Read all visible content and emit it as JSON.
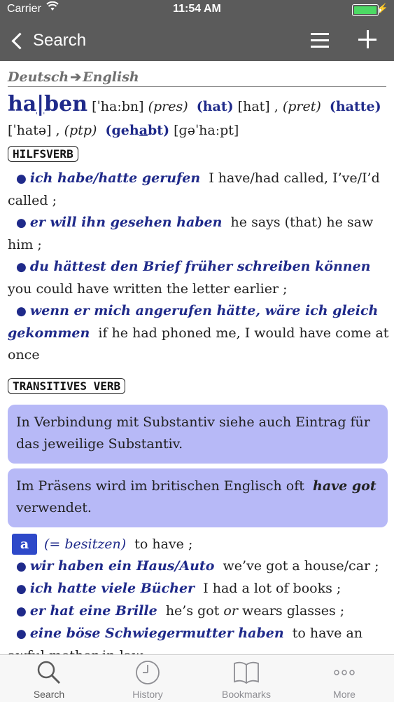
{
  "status_bar": {
    "carrier": "Carrier",
    "time": "11:54 AM"
  },
  "nav": {
    "back_label": "Search"
  },
  "direction": {
    "from": "Deutsch",
    "to": "English"
  },
  "entry": {
    "headword_pre": "ha",
    "headword_accent": "|",
    "headword_post": "ben",
    "pron": "[ˈhaːbn]",
    "pres_label": "(pres)",
    "pres_form": "(hat)",
    "pres_pron": "[hat] ,",
    "pret_label": "(pret)",
    "pret_form": "(hatte)",
    "pret_pron": "[ˈhatə] ,",
    "ptp_label": "(ptp)",
    "ptp_form_pre": "(geh",
    "ptp_form_accent": "a",
    "ptp_form_post": "bt)",
    "ptp_pron": "[ɡəˈhaːpt]"
  },
  "hilfsverb": {
    "label": "HILFSVERB",
    "examples": [
      {
        "de": "ich habe/hatte gerufen",
        "en": "I have/had called, I’ve/I’d called ;"
      },
      {
        "de": "er will ihn gesehen haben",
        "en": "he says (that) he saw him ;"
      },
      {
        "de": "du hättest den Brief früher schreiben können",
        "en": "you could have written the letter earlier ;"
      },
      {
        "de": "wenn er mich angerufen hätte, wäre ich gleich gekommen",
        "en": "if he had phoned me, I would have come at once"
      }
    ]
  },
  "transitives_verb": {
    "label": "TRANSITIVES VERB",
    "note1": "In Verbindung mit Substantiv siehe auch Eintrag für das jeweilige Substantiv.",
    "note2_pre": "Im Präsens wird im britischen Englisch oft",
    "note2_em": "have got",
    "note2_post": "verwendet.",
    "sense": {
      "badge": "a",
      "gloss": "(= besitzen)",
      "translation": "to have ;"
    },
    "examples": [
      {
        "de": "wir haben ein Haus/Auto",
        "en": "we’ve got a house/car ;"
      },
      {
        "de": "ich hatte viele Bücher",
        "en": "I had a lot of books ;"
      },
      {
        "de": "er hat eine Brille",
        "en_pre": "he’s got",
        "en_or": "or",
        "en_post": "wears glasses ;"
      },
      {
        "de": "eine böse Schwiegermutter haben",
        "en": "to have an awful mother-in-law ;"
      }
    ]
  },
  "tabs": [
    {
      "label": "Search"
    },
    {
      "label": "History"
    },
    {
      "label": "Bookmarks"
    },
    {
      "label": "More"
    }
  ]
}
